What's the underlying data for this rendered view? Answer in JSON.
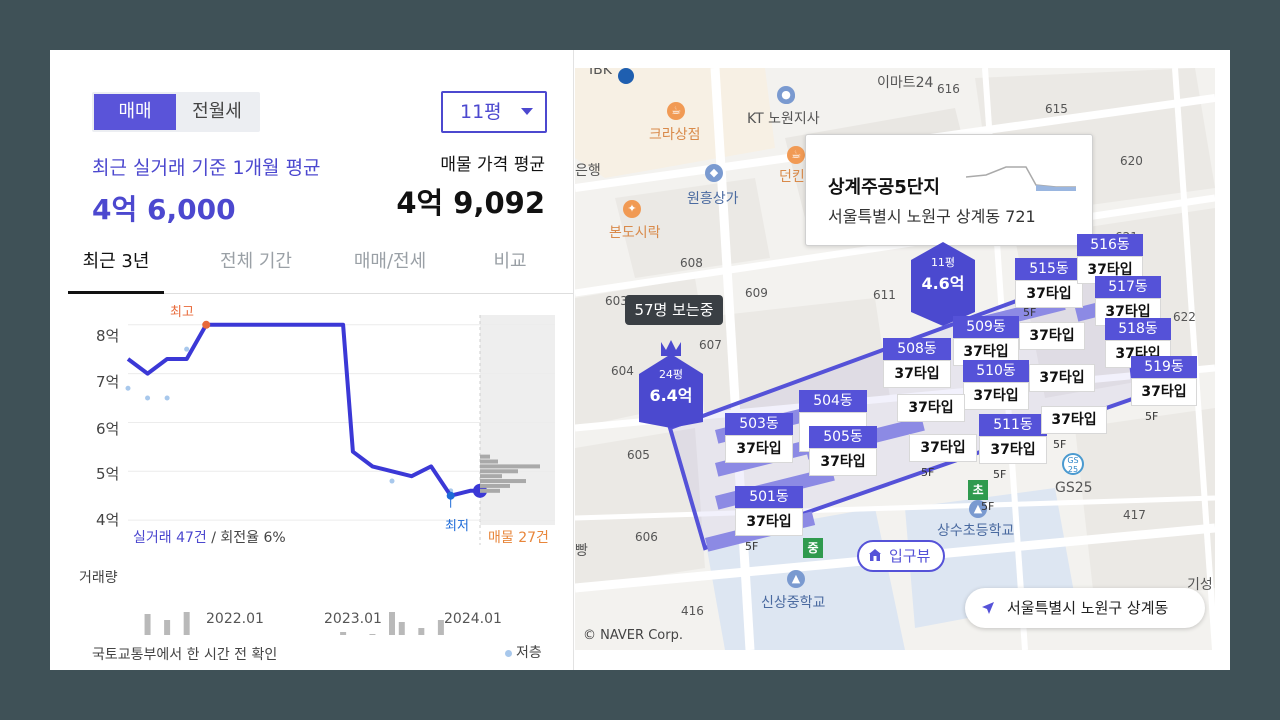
{
  "panel": {
    "trade_types": [
      "매매",
      "전월세"
    ],
    "size_select": "11평",
    "avg_label": "최근 실거래 기준 1개월 평균",
    "avg_value": "4억 6,000",
    "listing_label": "매물 가격 평균",
    "listing_value": "4억 9,092",
    "tabs": [
      "최근 3년",
      "전체 기간",
      "매매/전세",
      "비교"
    ],
    "chart": {
      "y_ticks": [
        "8억",
        "7억",
        "6억",
        "5억",
        "4억"
      ],
      "x_ticks": [
        "2022.01",
        "2023.01",
        "2024.01"
      ],
      "high_label": "최고",
      "low_label": "최저",
      "trade_count_prefix": "실거래 47건",
      "trade_count_suffix": " / 회전율 6%",
      "listing_count": "매물 27건",
      "volume_label": "거래량"
    },
    "footer_note": "국토교통부에서 한 시간 전 확인",
    "legend_note": "저층"
  },
  "chart_data": {
    "type": "line",
    "title": "",
    "xlabel": "",
    "ylabel": "",
    "y_unit": "억",
    "ylim": [
      3.9,
      8.2
    ],
    "x": [
      "2021.03",
      "2021.05",
      "2021.07",
      "2021.09",
      "2021.11",
      "2022.01",
      "2022.06",
      "2022.12",
      "2023.01",
      "2023.02",
      "2023.04",
      "2023.06",
      "2023.08",
      "2023.10",
      "2023.12",
      "2024.02",
      "2024.03"
    ],
    "series": [
      {
        "values": [
          7.3,
          7.0,
          7.3,
          7.3,
          8.0,
          8.0,
          8.0,
          8.0,
          8.0,
          5.4,
          5.1,
          5.0,
          4.9,
          5.1,
          4.5,
          4.6,
          4.6
        ]
      }
    ],
    "high": {
      "label": "최고",
      "value": 8.0
    },
    "low": {
      "label": "최저",
      "value": 4.5
    },
    "grid": "horizontal"
  },
  "map": {
    "info_card": {
      "name": "상계주공5단지",
      "address": "서울특별시 노원구 상계동 721"
    },
    "viewer_bubble": "57명 보는중",
    "pin_24": {
      "size": "24평",
      "price": "6.4억"
    },
    "pin_11": {
      "size": "11평",
      "price": "4.6억"
    },
    "buildings": [
      {
        "dong": "503동",
        "type": "37타입"
      },
      {
        "dong": "504동",
        "type": "37타입"
      },
      {
        "dong": "505동",
        "type": "37타입"
      },
      {
        "dong": "501동",
        "type": "37타입",
        "floor": "5F"
      },
      {
        "dong": "508동",
        "type": "37타입"
      },
      {
        "dong": "509동",
        "type": "37타입"
      },
      {
        "dong": "510동",
        "type": "37타입"
      },
      {
        "dong": "511동",
        "type": "37타입",
        "floor": "5F"
      },
      {
        "dong": "515동",
        "type": "37타입"
      },
      {
        "dong": "516동",
        "type": "37타입"
      },
      {
        "dong": "517동",
        "type": "37타입"
      },
      {
        "dong": "518동",
        "type": "37타입"
      },
      {
        "dong": "519동",
        "type": "37타입",
        "floor": "5F"
      }
    ],
    "extra_types": [
      "37타입",
      "37타입",
      "37타입"
    ],
    "floor_marks": [
      "5F",
      "5F",
      "5F",
      "5F"
    ],
    "entrance": "입구뷰",
    "location": "서울특별시 노원구 상계동",
    "copyright": "© NAVER Corp.",
    "pois": [
      "이마트24",
      "KT 노원지사",
      "크라상점",
      "원흥상가",
      "본도시락",
      "상수초등학교",
      "신상중학교",
      "GS25",
      "던킨",
      "은행",
      "빵",
      "기성"
    ],
    "lot_numbers": [
      "616",
      "615",
      "620",
      "608",
      "609",
      "611",
      "603",
      "604",
      "607",
      "605",
      "606",
      "621",
      "622",
      "417",
      "416"
    ],
    "school_flags": [
      "초",
      "중"
    ],
    "top_edge_text": "IBK",
    "colors": {
      "brand": "#5552d8",
      "accent": "#4c48cf",
      "high": "#e86a3a",
      "low": "#1e6bd8",
      "listing": "#e8863b"
    }
  }
}
